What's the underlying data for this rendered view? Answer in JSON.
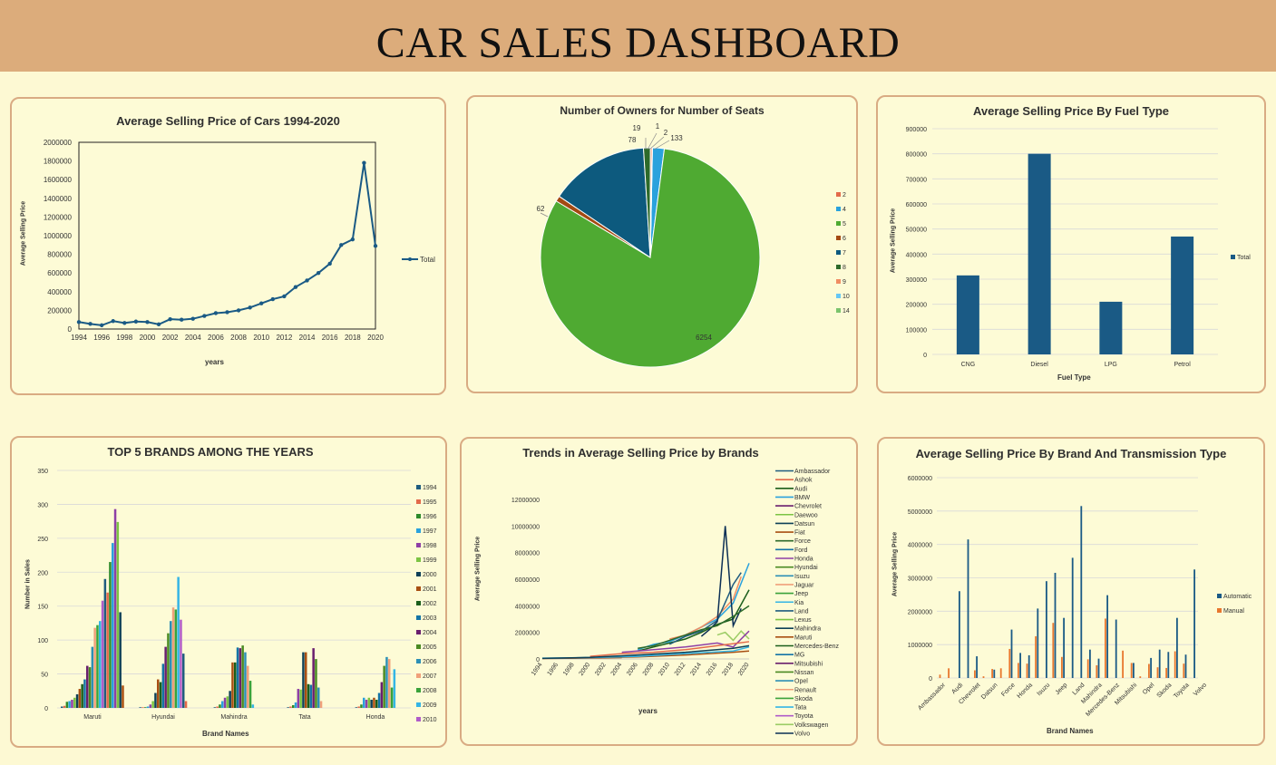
{
  "dashboard_title": "CAR SALES DASHBOARD",
  "colors": {
    "header": "#dcac7b",
    "background": "#fdf9d3",
    "border": "#d9ab83",
    "primary": "#1a5a85"
  },
  "chart_data": [
    {
      "id": "avg_price_years",
      "type": "line",
      "title": "Average Selling Price of Cars 1994-2020",
      "xlabel": "years",
      "ylabel": "Average Selling Price",
      "legend": [
        "Total"
      ],
      "x": [
        1994,
        1995,
        1996,
        1997,
        1998,
        1999,
        2000,
        2001,
        2002,
        2003,
        2004,
        2005,
        2006,
        2007,
        2008,
        2009,
        2010,
        2011,
        2012,
        2013,
        2014,
        2015,
        2016,
        2017,
        2018,
        2019,
        2020
      ],
      "values": [
        75000,
        55000,
        40000,
        85000,
        65000,
        80000,
        75000,
        50000,
        105000,
        100000,
        110000,
        140000,
        170000,
        180000,
        200000,
        230000,
        275000,
        320000,
        350000,
        450000,
        520000,
        600000,
        700000,
        900000,
        960000,
        1780000,
        890000
      ],
      "xticks": [
        "1994",
        "1996",
        "1998",
        "2000",
        "2002",
        "2004",
        "2006",
        "2008",
        "2010",
        "2012",
        "2014",
        "2016",
        "2018",
        "2020"
      ],
      "yticks": [
        "0",
        "200000",
        "400000",
        "600000",
        "800000",
        "1000000",
        "1200000",
        "1400000",
        "1600000",
        "1800000",
        "2000000"
      ],
      "ylim": [
        0,
        2000000
      ]
    },
    {
      "id": "owners_seats",
      "type": "pie",
      "title": "Number of Owners for Number of Seats",
      "categories": [
        "2",
        "4",
        "5",
        "6",
        "7",
        "8",
        "9",
        "10",
        "14"
      ],
      "values": [
        2,
        133,
        6254,
        62,
        1120,
        78,
        19,
        1,
        0
      ],
      "labels": [
        "2",
        "133",
        "6254",
        "62",
        "",
        "78",
        "19",
        "1",
        ""
      ],
      "colors": [
        "#e36a4a",
        "#2aa2dd",
        "#4faa32",
        "#a44a12",
        "#0d5a7e",
        "#2d6a2a",
        "#f08d63",
        "#66c7f4",
        "#7bc46d"
      ]
    },
    {
      "id": "fuel_type",
      "type": "bar",
      "title": "Average Selling Price By Fuel Type",
      "xlabel": "Fuel Type",
      "ylabel": "Average Selling Price",
      "legend": [
        "Total"
      ],
      "categories": [
        "CNG",
        "Diesel",
        "LPG",
        "Petrol"
      ],
      "values": [
        315000,
        800000,
        210000,
        470000
      ],
      "yticks": [
        "0",
        "100000",
        "200000",
        "300000",
        "400000",
        "500000",
        "600000",
        "700000",
        "800000",
        "900000"
      ],
      "ylim": [
        0,
        900000
      ]
    },
    {
      "id": "top5_brands",
      "type": "bar",
      "title": "TOP 5 BRANDS AMONG THE YEARS",
      "xlabel": "Brand Names",
      "ylabel": "Number in Sales",
      "categories": [
        "Maruti",
        "Hyundai",
        "Mahindra",
        "Tata",
        "Honda"
      ],
      "yticks": [
        "0",
        "50",
        "100",
        "150",
        "200",
        "250",
        "300",
        "350"
      ],
      "ylim": [
        0,
        350
      ],
      "legend": [
        "1994",
        "1995",
        "1996",
        "1997",
        "1998",
        "1999",
        "2000",
        "2001",
        "2002",
        "2003",
        "2004",
        "2005",
        "2006",
        "2007",
        "2008",
        "2009",
        "2010"
      ],
      "series_colors": [
        "#1f5c7f",
        "#e36a4a",
        "#2d8a2a",
        "#2aa2dd",
        "#8e3fa6",
        "#7cc443",
        "#0e4057",
        "#a84f12",
        "#1b5e1b",
        "#1474a6",
        "#6a1f6e",
        "#4a8a22",
        "#2d8fb5",
        "#f0a07a",
        "#3aa23a",
        "#35b5e5",
        "#b05cc9"
      ],
      "series": [
        [
          2,
          3,
          9,
          10,
          12,
          15,
          20,
          28,
          35,
          42,
          62,
          60,
          90,
          118,
          122,
          128,
          158,
          190,
          170,
          215,
          243,
          293,
          274,
          141,
          33
        ],
        [
          1,
          1,
          1,
          2,
          5,
          10,
          22,
          42,
          38,
          65,
          90,
          110,
          128,
          148,
          145,
          193,
          130,
          80,
          10
        ],
        [
          1,
          2,
          5,
          10,
          15,
          17,
          25,
          67,
          67,
          89,
          88,
          92,
          82,
          62,
          40,
          5
        ],
        [
          1,
          2,
          4,
          8,
          28,
          27,
          82,
          82,
          35,
          34,
          88,
          72,
          30,
          10
        ],
        [
          1,
          2,
          5,
          15,
          12,
          15,
          12,
          15,
          12,
          22,
          38,
          62,
          75,
          72,
          30,
          57
        ]
      ]
    },
    {
      "id": "brand_trends",
      "type": "line",
      "title": "Trends in Average Selling Price by Brands",
      "xlabel": "years",
      "ylabel": "Average Selling Price",
      "xticks": [
        "1994",
        "1996",
        "1998",
        "2000",
        "2002",
        "2004",
        "2006",
        "2008",
        "2010",
        "2012",
        "2014",
        "2016",
        "2018",
        "2020"
      ],
      "yticks": [
        "0",
        "2000000",
        "4000000",
        "6000000",
        "8000000",
        "10000000",
        "12000000"
      ],
      "ylim": [
        0,
        12000000
      ],
      "legend": [
        "Ambassador",
        "Ashok",
        "Audi",
        "BMW",
        "Chevrolet",
        "Daewoo",
        "Datsun",
        "Fiat",
        "Force",
        "Ford",
        "Honda",
        "Hyundai",
        "Isuzu",
        "Jaguar",
        "Jeep",
        "Kia",
        "Land",
        "Lexus",
        "Mahindra",
        "Maruti",
        "Mercedes-Benz",
        "MG",
        "Mitsubishi",
        "Nissan",
        "Opel",
        "Renault",
        "Skoda",
        "Tata",
        "Toyota",
        "Volkswagen",
        "Volvo"
      ],
      "legend_colors": [
        "#1f5c7f",
        "#e36a4a",
        "#1b5e1b",
        "#2aa2dd",
        "#6a1f6e",
        "#7cc443",
        "#0e4057",
        "#a84f12",
        "#2d6a2a",
        "#1474a6",
        "#8e3fa6",
        "#4a8a22",
        "#2d8fb5",
        "#f0a07a",
        "#3aa23a",
        "#35b5e5",
        "#1f5c7f",
        "#7cc443",
        "#0e4057",
        "#a84f12",
        "#1b5e1b",
        "#1474a6",
        "#6a1f6e",
        "#4a8a22",
        "#2d8fb5",
        "#f0a07a",
        "#3aa23a",
        "#35b5e5",
        "#b05cc9",
        "#9ccc65",
        "#0b2f55"
      ],
      "series": [
        {
          "name": "Audi",
          "color": "#1b5e1b",
          "points": [
            [
              2006,
              600000
            ],
            [
              2008,
              900000
            ],
            [
              2010,
              1200000
            ],
            [
              2012,
              1500000
            ],
            [
              2014,
              2000000
            ],
            [
              2016,
              2600000
            ],
            [
              2018,
              3000000
            ],
            [
              2020,
              5200000
            ]
          ]
        },
        {
          "name": "BMW",
          "color": "#2aa2dd",
          "points": [
            [
              2006,
              700000
            ],
            [
              2008,
              1100000
            ],
            [
              2010,
              1300000
            ],
            [
              2012,
              1800000
            ],
            [
              2014,
              2400000
            ],
            [
              2016,
              3000000
            ],
            [
              2018,
              4200000
            ],
            [
              2020,
              7200000
            ]
          ]
        },
        {
          "name": "Jaguar",
          "color": "#f08d63",
          "points": [
            [
              2010,
              1500000
            ],
            [
              2012,
              1800000
            ],
            [
              2014,
              2400000
            ],
            [
              2016,
              3200000
            ],
            [
              2018,
              4500000
            ],
            [
              2019,
              6200000
            ]
          ]
        },
        {
          "name": "Land",
          "color": "#1f5c7f",
          "points": [
            [
              2010,
              1100000
            ],
            [
              2012,
              1700000
            ],
            [
              2014,
              2100000
            ],
            [
              2016,
              2900000
            ],
            [
              2018,
              5600000
            ],
            [
              2019,
              6500000
            ]
          ]
        },
        {
          "name": "Volvo",
          "color": "#0b2f55",
          "points": [
            [
              2014,
              1700000
            ],
            [
              2015,
              2200000
            ],
            [
              2016,
              2800000
            ],
            [
              2017,
              10000000
            ],
            [
              2018,
              2500000
            ],
            [
              2019,
              3800000
            ]
          ]
        },
        {
          "name": "Mercedes-Benz",
          "color": "#2d6a2a",
          "points": [
            [
              2006,
              800000
            ],
            [
              2008,
              1000000
            ],
            [
              2010,
              1400000
            ],
            [
              2012,
              1800000
            ],
            [
              2014,
              2200000
            ],
            [
              2016,
              2500000
            ],
            [
              2018,
              3200000
            ],
            [
              2020,
              4000000
            ]
          ]
        },
        {
          "name": "Lexus",
          "color": "#9ccc65",
          "points": [
            [
              2016,
              1800000
            ],
            [
              2017,
              2000000
            ],
            [
              2018,
              1400000
            ],
            [
              2019,
              2100000
            ],
            [
              2020,
              1500000
            ]
          ]
        },
        {
          "name": "Mitsubishi",
          "color": "#8e3fa6",
          "points": [
            [
              2004,
              500000
            ],
            [
              2008,
              700000
            ],
            [
              2012,
              900000
            ],
            [
              2016,
              1200000
            ],
            [
              2018,
              900000
            ],
            [
              2020,
              2100000
            ]
          ]
        },
        {
          "name": "Toyota",
          "color": "#e36a4a",
          "points": [
            [
              2000,
              200000
            ],
            [
              2004,
              400000
            ],
            [
              2008,
              500000
            ],
            [
              2012,
              700000
            ],
            [
              2016,
              1000000
            ],
            [
              2020,
              1300000
            ]
          ]
        },
        {
          "name": "Maruti",
          "color": "#a84f12",
          "points": [
            [
              1994,
              50000
            ],
            [
              2000,
              80000
            ],
            [
              2006,
              150000
            ],
            [
              2012,
              300000
            ],
            [
              2018,
              500000
            ],
            [
              2020,
              600000
            ]
          ]
        },
        {
          "name": "Tata",
          "color": "#35b5e5",
          "points": [
            [
              1994,
              60000
            ],
            [
              2000,
              100000
            ],
            [
              2006,
              200000
            ],
            [
              2012,
              400000
            ],
            [
              2018,
              600000
            ],
            [
              2020,
              900000
            ]
          ]
        },
        {
          "name": "Mahindra",
          "color": "#0e4057",
          "points": [
            [
              1994,
              40000
            ],
            [
              2000,
              120000
            ],
            [
              2006,
              300000
            ],
            [
              2012,
              500000
            ],
            [
              2018,
              800000
            ],
            [
              2020,
              1000000
            ]
          ]
        }
      ]
    },
    {
      "id": "brand_transmission",
      "type": "bar",
      "title": "Average Selling Price By Brand And Transmission Type",
      "xlabel": "Brand Names",
      "ylabel": "Average Selling Price",
      "legend": [
        "Automatic",
        "Manual"
      ],
      "legend_colors": [
        "#1a5a85",
        "#e8772e"
      ],
      "tick_labels": [
        "Ambassador",
        "Audi",
        "Chevrolet",
        "Datsun",
        "Force",
        "Honda",
        "Isuzu",
        "Jeep",
        "Land",
        "Mahindra",
        "Mercedes-Benz",
        "Mitsubishi",
        "Opel",
        "Skoda",
        "Toyota",
        "Volvo"
      ],
      "yticks": [
        "0",
        "1000000",
        "2000000",
        "3000000",
        "4000000",
        "5000000",
        "6000000"
      ],
      "ylim": [
        0,
        6000000
      ],
      "automatic": [
        0,
        0,
        2600000,
        4150000,
        650000,
        0,
        250000,
        0,
        1450000,
        750000,
        680000,
        2080000,
        2900000,
        3150000,
        1800000,
        3600000,
        5150000,
        850000,
        580000,
        2480000,
        1750000,
        0,
        450000,
        0,
        600000,
        850000,
        780000,
        1800000,
        700000,
        3250000
      ],
      "manual": [
        100000,
        290000,
        0,
        0,
        230000,
        50000,
        270000,
        290000,
        870000,
        450000,
        430000,
        1250000,
        0,
        1650000,
        630000,
        0,
        0,
        560000,
        380000,
        1780000,
        0,
        820000,
        450000,
        50000,
        420000,
        320000,
        300000,
        800000,
        430000,
        0
      ]
    }
  ]
}
